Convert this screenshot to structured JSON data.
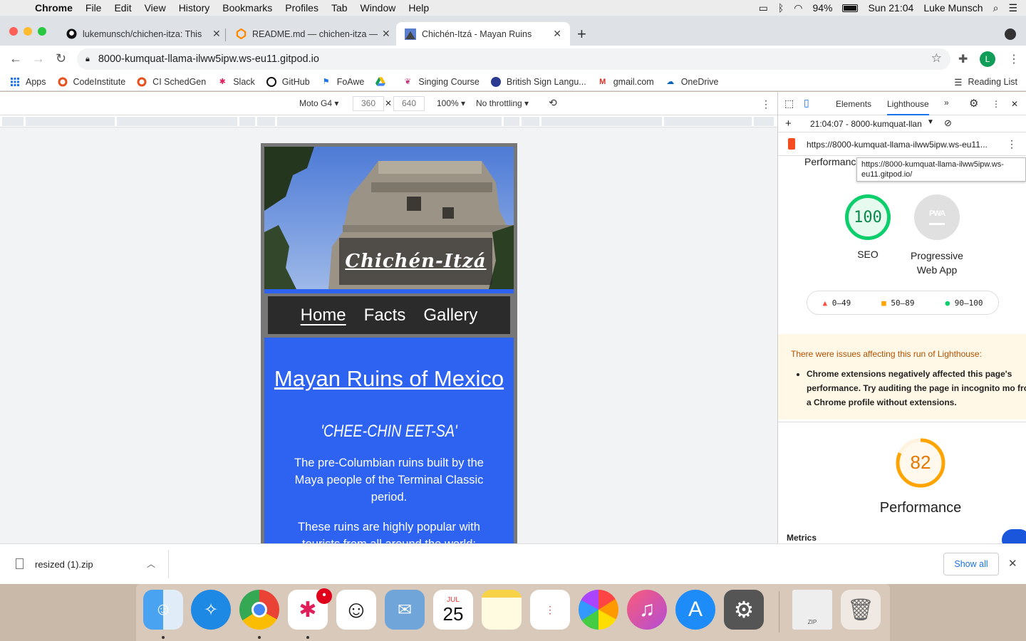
{
  "menubar": {
    "items": [
      "Chrome",
      "File",
      "Edit",
      "View",
      "History",
      "Bookmarks",
      "Profiles",
      "Tab",
      "Window",
      "Help"
    ],
    "battery": "94%",
    "clock": "Sun 21:04",
    "user": "Luke Munsch"
  },
  "tabs": [
    {
      "title": "lukemunsch/chichen-itza: This",
      "icon": "github-icon"
    },
    {
      "title": "README.md — chichen-itza —",
      "icon": "gitpod-icon"
    },
    {
      "title": "Chichén-Itzá - Mayan Ruins",
      "icon": "pyramid-icon"
    }
  ],
  "toolbar": {
    "url": "8000-kumquat-llama-ilww5ipw.ws-eu11.gitpod.io",
    "profile_initial": "L"
  },
  "bookmarks": {
    "items": [
      "Apps",
      "CodeInstitute",
      "CI SchedGen",
      "Slack",
      "GitHub",
      "FoAwe",
      "",
      "Singing Course",
      "British Sign Langu...",
      "gmail.com",
      "OneDrive"
    ],
    "reading_list": "Reading List"
  },
  "device": {
    "name": "Moto G4",
    "width": "360",
    "height": "640",
    "zoom": "100%",
    "throttle": "No throttling"
  },
  "site": {
    "hero_title": "Chichén-Itzá",
    "nav": [
      "Home",
      "Facts",
      "Gallery"
    ],
    "heading": "Mayan Ruins of Mexico",
    "phonetic": "'CHEE-CHIN EET-SA'",
    "para1": "The pre-Columbian ruins built by the Maya people of the Terminal Classic period.",
    "para2": "These ruins are highly popular with tourists from all around the world:"
  },
  "devtools": {
    "tabs": [
      "Elements",
      "Lighthouse"
    ],
    "report_time": "21:04:07 - 8000-kumquat-llan",
    "report_url": "https://8000-kumquat-llama-ilww5ipw.ws-eu11...",
    "tooltip": "https://8000-kumquat-llama-ilww5ipw.ws-eu11.gitpod.io/",
    "partial_label": "Performanc",
    "seo_score": "100",
    "seo_label": "SEO",
    "pwa_badge": "PWA",
    "pwa_label": "Progressive Web App",
    "legend": [
      "0–49",
      "50–89",
      "90–100"
    ],
    "warning_title": "There were issues affecting this run of Lighthouse:",
    "warning_text": "Chrome extensions negatively affected this page's performance. Try auditing the page in incognito mo from a Chrome profile without extensions.",
    "perf_score": "82",
    "perf_score_value": 0.82,
    "perf_label": "Performance",
    "metrics_label": "Metrics",
    "colors": {
      "good": "#0cce6b",
      "average": "#ffa400",
      "fail": "#ff4e42"
    }
  },
  "downloads": {
    "file": "resized (1).zip",
    "show_all": "Show all"
  },
  "dock": {
    "calendar_month": "JUL",
    "calendar_day": "25",
    "zip_label": "ZIP",
    "apps": [
      "finder-icon",
      "safari-icon",
      "chrome-icon",
      "slack-icon",
      "smiley-icon",
      "mail-icon",
      "calendar-icon",
      "notes-icon",
      "reminders-icon",
      "photos-icon",
      "music-icon",
      "app-store-icon",
      "system-preferences-icon",
      "zip-file-icon",
      "trash-icon"
    ],
    "slack_badge": "•"
  }
}
